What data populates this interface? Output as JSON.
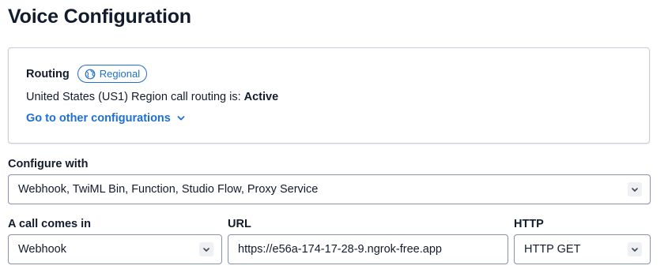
{
  "header": {
    "title": "Voice Configuration"
  },
  "routing": {
    "label": "Routing",
    "badge": "Regional",
    "status_prefix": "United States (US1) Region call routing is: ",
    "status_value": "Active",
    "other_link": "Go to other configurations"
  },
  "configure_with": {
    "label": "Configure with",
    "value": "Webhook, TwiML Bin, Function, Studio Flow, Proxy Service"
  },
  "call_comes_in": {
    "label": "A call comes in",
    "value": "Webhook"
  },
  "url": {
    "label": "URL",
    "value": "https://e56a-174-17-28-9.ngrok-free.app"
  },
  "http": {
    "label": "HTTP",
    "value": "HTTP GET"
  },
  "colors": {
    "link": "#1f6fd0",
    "text": "#121c2d",
    "border": "#8891aa"
  },
  "icons": {
    "badge": "globe-icon",
    "dropdown": "chevron-down-icon"
  }
}
